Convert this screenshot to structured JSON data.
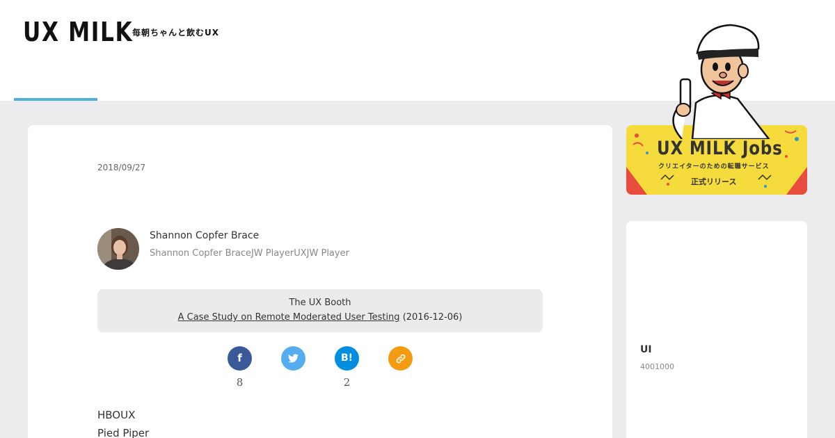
{
  "header": {
    "logo": "UX MILK",
    "tagline": "毎朝ちゃんと飲むUX"
  },
  "article": {
    "date": "2018/09/27",
    "title": "",
    "author": {
      "name": "Shannon Copfer Brace",
      "bio": "Shannon Copfer BraceJW PlayerUXJW Player"
    },
    "source": {
      "publication": "The UX Booth",
      "link_text": "A Case Study on Remote Moderated User Testing",
      "date_text": "(2016-12-06)"
    },
    "share": {
      "facebook": {
        "icon": "f",
        "count": "8",
        "color": "#3b5998"
      },
      "twitter": {
        "icon": "🐦",
        "count": "",
        "color": "#55acee"
      },
      "hatena": {
        "icon": "B!",
        "count": "2",
        "color": "#008fde"
      },
      "copy_link": {
        "icon": "🔗",
        "count": "",
        "color": "#f39c12"
      }
    },
    "body": {
      "line1_prefix": "HBO",
      "line1_link": "",
      "line1_rest": "UX",
      "line2": "Pied Piper"
    }
  },
  "sidebar": {
    "jobs_banner": {
      "title": "UX MILK Jobs",
      "subtitle": "クリエイターのための転職サービス",
      "release": "正式リリース"
    },
    "card": {
      "heading": "",
      "item_title": "UI",
      "item_meta": "4001000"
    }
  },
  "colors": {
    "accent": "#4fb0d9",
    "background": "#ececef",
    "banner_yellow": "#f5dc3c"
  }
}
